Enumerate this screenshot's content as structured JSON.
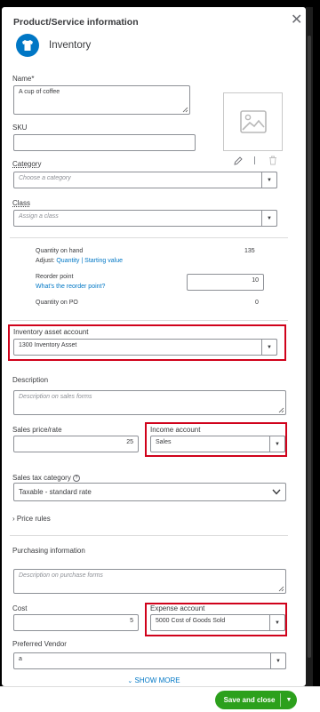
{
  "header": {
    "title": "Product/Service information",
    "type_label": "Inventory"
  },
  "name": {
    "label": "Name*",
    "value": "A cup of coffee"
  },
  "sku": {
    "label": "SKU",
    "value": ""
  },
  "category": {
    "label": "Category",
    "placeholder": "Choose a category"
  },
  "class": {
    "label": "Class",
    "placeholder": "Assign a class"
  },
  "quantity": {
    "on_hand_label": "Quantity on hand",
    "on_hand_value": "135",
    "adjust_prefix": "Adjust:",
    "adjust_quantity": "Quantity",
    "adjust_sep": "|",
    "adjust_starting": "Starting value",
    "reorder_label": "Reorder point",
    "reorder_link": "What's the reorder point?",
    "reorder_value": "10",
    "on_po_label": "Quantity on PO",
    "on_po_value": "0"
  },
  "inventory_asset": {
    "label": "Inventory asset account",
    "value": "1300 Inventory Asset"
  },
  "description": {
    "label": "Description",
    "placeholder": "Description on sales forms"
  },
  "sales_price": {
    "label": "Sales price/rate",
    "value": "25"
  },
  "income_account": {
    "label": "Income account",
    "value": "Sales"
  },
  "sales_tax": {
    "label": "Sales tax category",
    "value": "Taxable - standard rate"
  },
  "price_rules": {
    "label": "Price rules"
  },
  "purchasing": {
    "label": "Purchasing information",
    "placeholder": "Description on purchase forms"
  },
  "cost": {
    "label": "Cost",
    "value": "5"
  },
  "expense_account": {
    "label": "Expense account",
    "value": "5000 Cost of Goods Sold"
  },
  "vendor": {
    "label": "Preferred Vendor",
    "value": "a"
  },
  "show_more": "SHOW MORE",
  "footer": {
    "save_label": "Save and close"
  },
  "colors": {
    "accent": "#0077c5",
    "highlight": "#d0021b",
    "save": "#2ca01c"
  }
}
